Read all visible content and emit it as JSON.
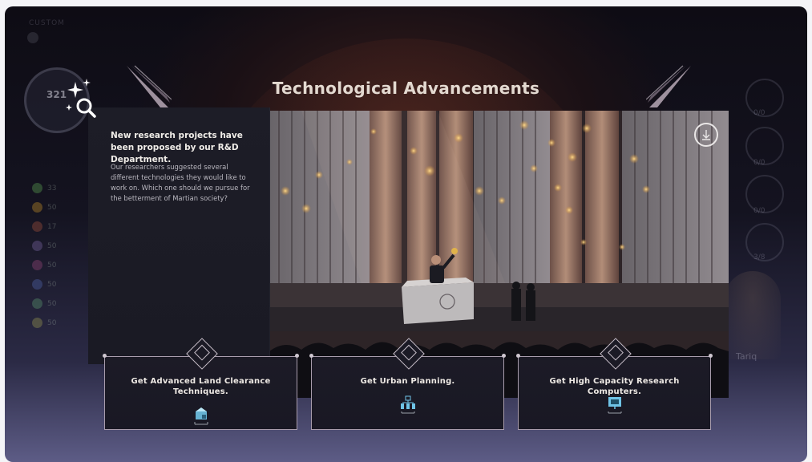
{
  "event": {
    "title": "Technological Advancements",
    "heading": "New research projects have been proposed by our R&D Department.",
    "body": "Our researchers suggested several different technologies they would like to work on. Which one should we pursue for the betterment of Martian society?"
  },
  "choices": [
    {
      "label": "Get Advanced Land Clearance Techniques.",
      "icon": "land-clearance-icon"
    },
    {
      "label": "Get Urban Planning.",
      "icon": "urban-planning-icon"
    },
    {
      "label": "Get High Capacity Research Computers.",
      "icon": "research-computer-icon"
    }
  ],
  "hud": {
    "mode_label": "CUSTOM",
    "score": "321",
    "resources": [
      "33",
      "50",
      "17",
      "50",
      "50",
      "50",
      "50",
      "50"
    ],
    "right_values": [
      "0/0",
      "0/0",
      "0/0",
      "3/8"
    ],
    "advisor_name": "Tariq"
  },
  "colors": {
    "panel": "#1c1b26",
    "card_border": "#a99dad",
    "title": "#e3d9d0",
    "icon_accent": "#6fc3e6"
  }
}
